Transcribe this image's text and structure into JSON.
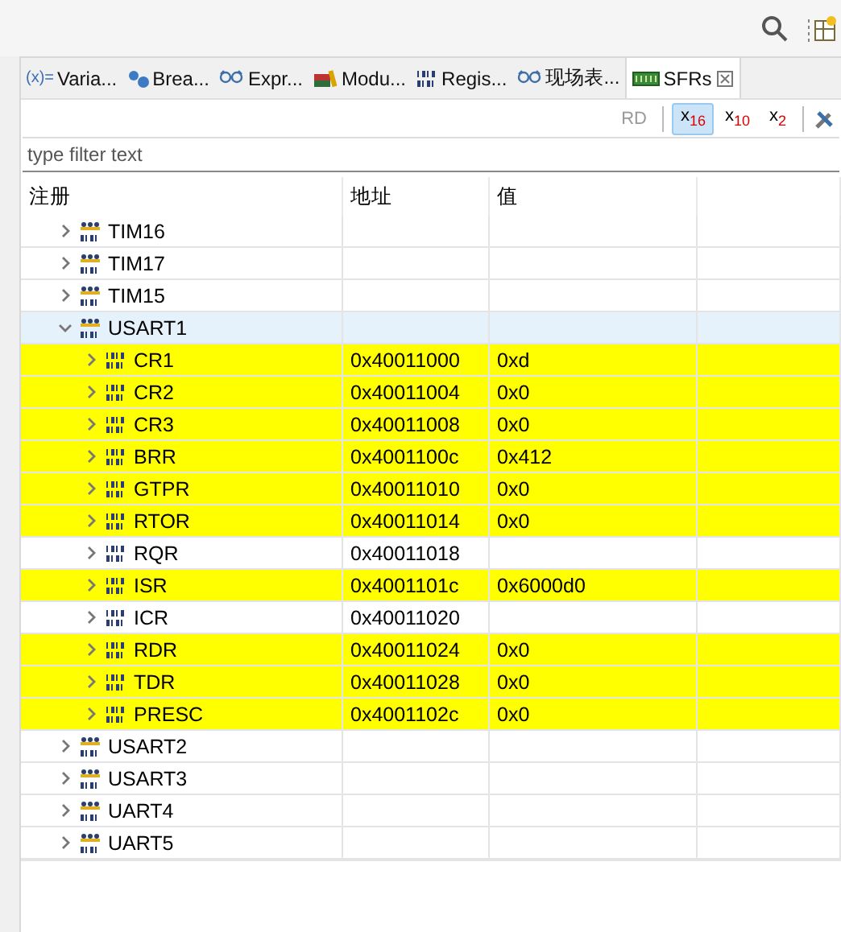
{
  "tabs": [
    {
      "label": "Varia...",
      "kind": "variables",
      "glyph": "(x)=",
      "selected": false
    },
    {
      "label": "Brea...",
      "kind": "breakpoints",
      "selected": false
    },
    {
      "label": "Expr...",
      "kind": "expressions",
      "selected": false
    },
    {
      "label": "Modu...",
      "kind": "modules",
      "selected": false
    },
    {
      "label": "Regis...",
      "kind": "registers",
      "selected": false
    },
    {
      "label": "现场表...",
      "kind": "expressions",
      "selected": false
    },
    {
      "label": "SFRs",
      "kind": "sfrs",
      "selected": true
    }
  ],
  "toolbar": [
    {
      "label": "RD",
      "disabled": true,
      "selected": false
    },
    {
      "label": "x",
      "sub": "16",
      "disabled": false,
      "selected": true
    },
    {
      "label": "x",
      "sub": "10",
      "disabled": false,
      "selected": false
    },
    {
      "label": "x",
      "sub": "2",
      "disabled": false,
      "selected": false
    }
  ],
  "filter": {
    "placeholder": "type filter text"
  },
  "table": {
    "columns": [
      "注册",
      "地址",
      "值"
    ],
    "rows": [
      {
        "name": "TIM16",
        "expanded": false,
        "selected": false
      },
      {
        "name": "TIM17",
        "expanded": false,
        "selected": false
      },
      {
        "name": "TIM15",
        "expanded": false,
        "selected": false
      },
      {
        "name": "USART1",
        "expanded": true,
        "selected": true,
        "children": [
          {
            "name": "CR1",
            "address": "0x40011000",
            "value": "0xd",
            "changed": true
          },
          {
            "name": "CR2",
            "address": "0x40011004",
            "value": "0x0",
            "changed": true
          },
          {
            "name": "CR3",
            "address": "0x40011008",
            "value": "0x0",
            "changed": true
          },
          {
            "name": "BRR",
            "address": "0x4001100c",
            "value": "0x412",
            "changed": true
          },
          {
            "name": "GTPR",
            "address": "0x40011010",
            "value": "0x0",
            "changed": true
          },
          {
            "name": "RTOR",
            "address": "0x40011014",
            "value": "0x0",
            "changed": true
          },
          {
            "name": "RQR",
            "address": "0x40011018",
            "changed": false
          },
          {
            "name": "ISR",
            "address": "0x4001101c",
            "value": "0x6000d0",
            "changed": true
          },
          {
            "name": "ICR",
            "address": "0x40011020",
            "changed": false
          },
          {
            "name": "RDR",
            "address": "0x40011024",
            "value": "0x0",
            "changed": true
          },
          {
            "name": "TDR",
            "address": "0x40011028",
            "value": "0x0",
            "changed": true
          },
          {
            "name": "PRESC",
            "address": "0x4001102c",
            "value": "0x0",
            "changed": true
          }
        ]
      },
      {
        "name": "USART2",
        "expanded": false,
        "selected": false
      },
      {
        "name": "USART3",
        "expanded": false,
        "selected": false
      },
      {
        "name": "UART4",
        "expanded": false,
        "selected": false
      },
      {
        "name": "UART5",
        "expanded": false,
        "selected": false
      }
    ]
  }
}
